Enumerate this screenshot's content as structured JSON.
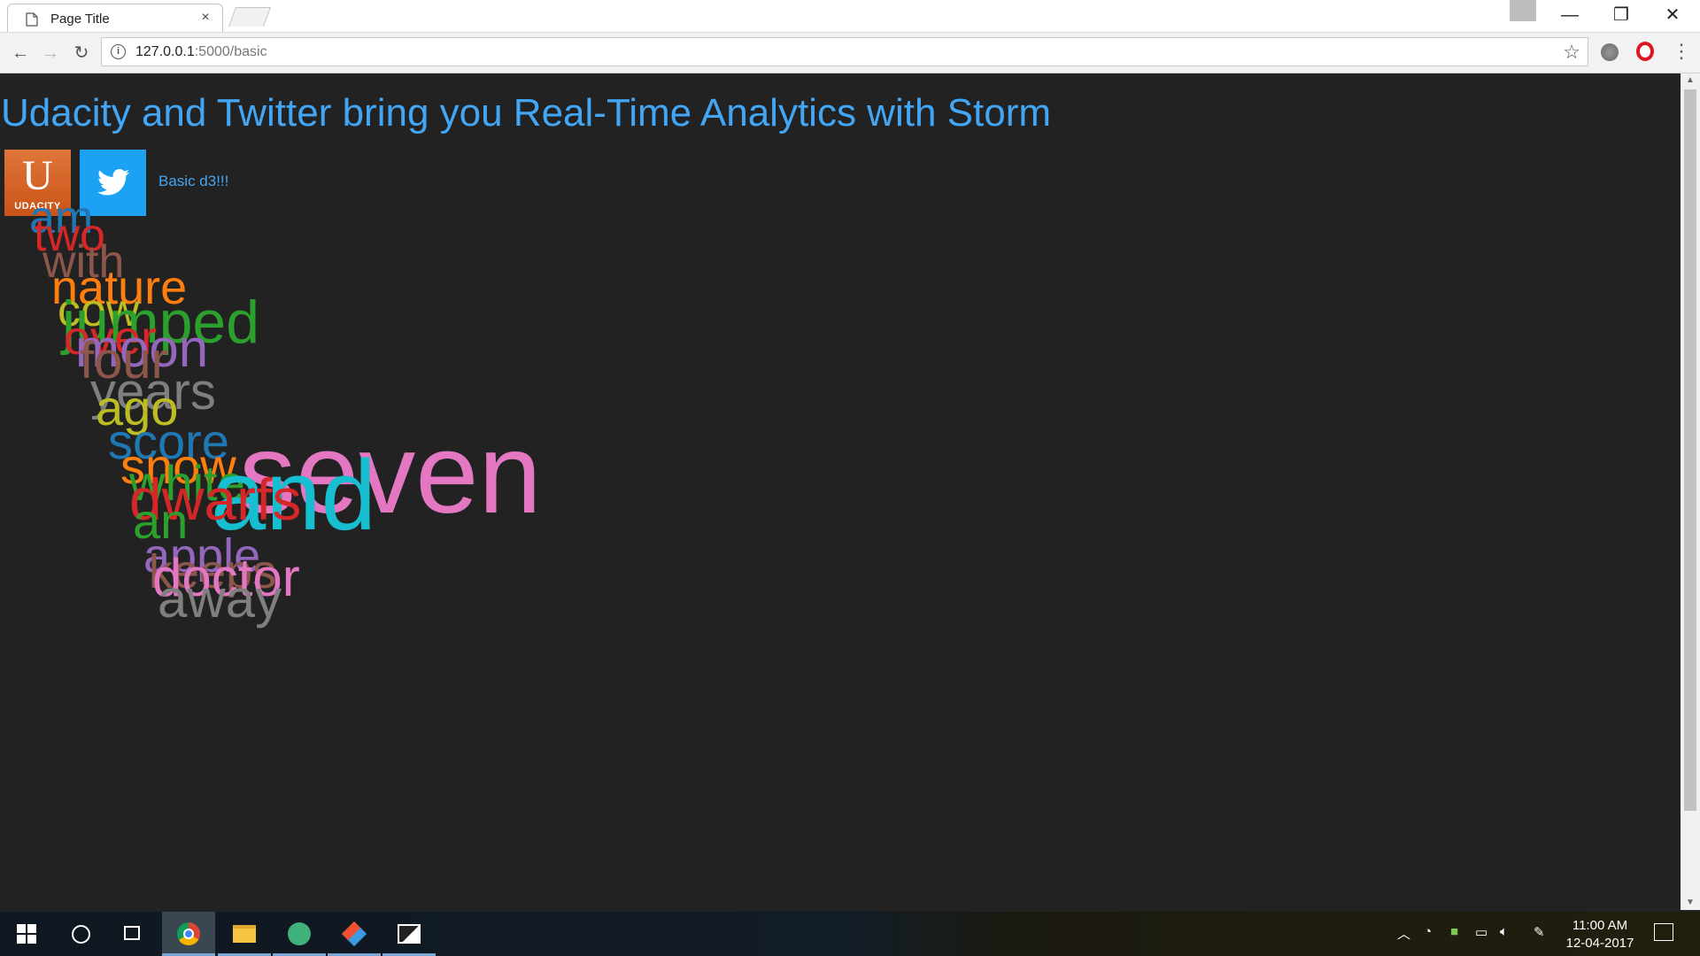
{
  "browser": {
    "tab_title": "Page Title",
    "tab_close": "×",
    "url_host": "127.0.0.1",
    "url_path": ":5000/basic",
    "window_minimize": "—",
    "window_restore": "❐",
    "window_close": "✕",
    "back": "←",
    "forward": "→",
    "reload": "↻",
    "bookmark_star": "☆",
    "menu": "⋮",
    "info": "i"
  },
  "page": {
    "title": "Udacity and Twitter bring you Real-Time Analytics with Storm",
    "udacity_logo_letter": "U",
    "udacity_logo_text": "UDACITY",
    "link_label": "Basic d3!!!"
  },
  "word_cloud": {
    "words": [
      {
        "text": "am",
        "color": "#1f77b4"
      },
      {
        "text": "two",
        "color": "#d62728"
      },
      {
        "text": "with",
        "color": "#8c564b"
      },
      {
        "text": "nature",
        "color": "#ff7f0e"
      },
      {
        "text": "cow",
        "color": "#bcbd22"
      },
      {
        "text": "jumped",
        "color": "#2ca02c"
      },
      {
        "text": "over",
        "color": "#d62728"
      },
      {
        "text": "moon",
        "color": "#9467bd"
      },
      {
        "text": "four",
        "color": "#8c564b"
      },
      {
        "text": "years",
        "color": "#7f7f7f"
      },
      {
        "text": "ago",
        "color": "#bcbd22"
      },
      {
        "text": "score",
        "color": "#1f77b4"
      },
      {
        "text": "seven",
        "color": "#e377c2"
      },
      {
        "text": "snow",
        "color": "#ff7f0e"
      },
      {
        "text": "white",
        "color": "#2ca02c"
      },
      {
        "text": "and",
        "color": "#17becf"
      },
      {
        "text": "dwarfs",
        "color": "#d62728"
      },
      {
        "text": "an",
        "color": "#2ca02c"
      },
      {
        "text": "apple",
        "color": "#9467bd"
      },
      {
        "text": "keeps",
        "color": "#8c564b"
      },
      {
        "text": "doctor",
        "color": "#e377c2"
      },
      {
        "text": "away",
        "color": "#7f7f7f"
      }
    ]
  },
  "taskbar": {
    "time": "11:00 AM",
    "date": "12-04-2017"
  },
  "colors": {
    "background": "#222222",
    "accent": "#42a6f5",
    "udacity": "#e0763a",
    "twitter": "#1da1f2"
  }
}
